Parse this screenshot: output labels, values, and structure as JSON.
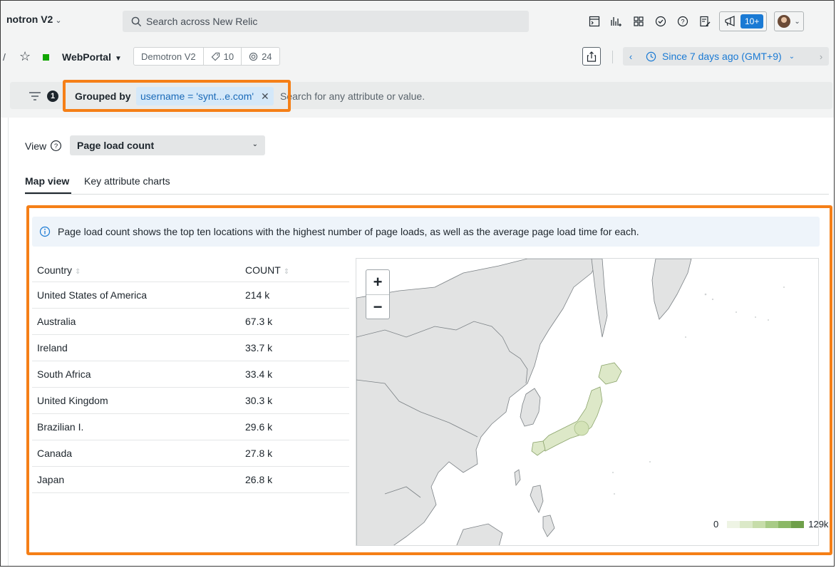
{
  "topbar": {
    "account_name": "notron V2",
    "search_placeholder": "Search across New Relic",
    "notification_count": "10+"
  },
  "entity": {
    "name": "WebPortal",
    "account_tag": "Demotron V2",
    "tag_count": "10",
    "related_count": "24",
    "time_range": "Since 7 days ago (GMT+9)"
  },
  "filter": {
    "filter_count": "1",
    "grouped_by_label": "Grouped by",
    "chip_text": "username = 'synt...e.com'",
    "search_placeholder": "Search for any attribute or value."
  },
  "view": {
    "label": "View",
    "selected": "Page load count"
  },
  "tabs": [
    {
      "label": "Map view",
      "active": true
    },
    {
      "label": "Key attribute charts",
      "active": false
    }
  ],
  "info_text": "Page load count shows the top ten locations with the highest number of page loads, as well as the average page load time for each.",
  "table": {
    "col_country": "Country",
    "col_count": "COUNT",
    "rows": [
      {
        "country": "United States of America",
        "count": "214 k"
      },
      {
        "country": "Australia",
        "count": "67.3 k"
      },
      {
        "country": "Ireland",
        "count": "33.7 k"
      },
      {
        "country": "South Africa",
        "count": "33.4 k"
      },
      {
        "country": "United Kingdom",
        "count": "30.3 k"
      },
      {
        "country": "Brazilian I.",
        "count": "29.6 k"
      },
      {
        "country": "Canada",
        "count": "27.8 k"
      },
      {
        "country": "Japan",
        "count": "26.8 k"
      }
    ]
  },
  "map": {
    "zoom_in": "+",
    "zoom_out": "−",
    "legend_min": "0",
    "legend_max": "129k",
    "legend_colors": [
      "#eef4e4",
      "#dbe9c8",
      "#c7ddaa",
      "#a8cb86",
      "#8bb866",
      "#6fa04a"
    ],
    "land_color": "#e2e3e3",
    "highlight_color": "#dde8c8"
  },
  "colors": {
    "accent": "#1a7ad4",
    "highlight_outline": "#f57f17",
    "entity_status": "#11a600"
  }
}
